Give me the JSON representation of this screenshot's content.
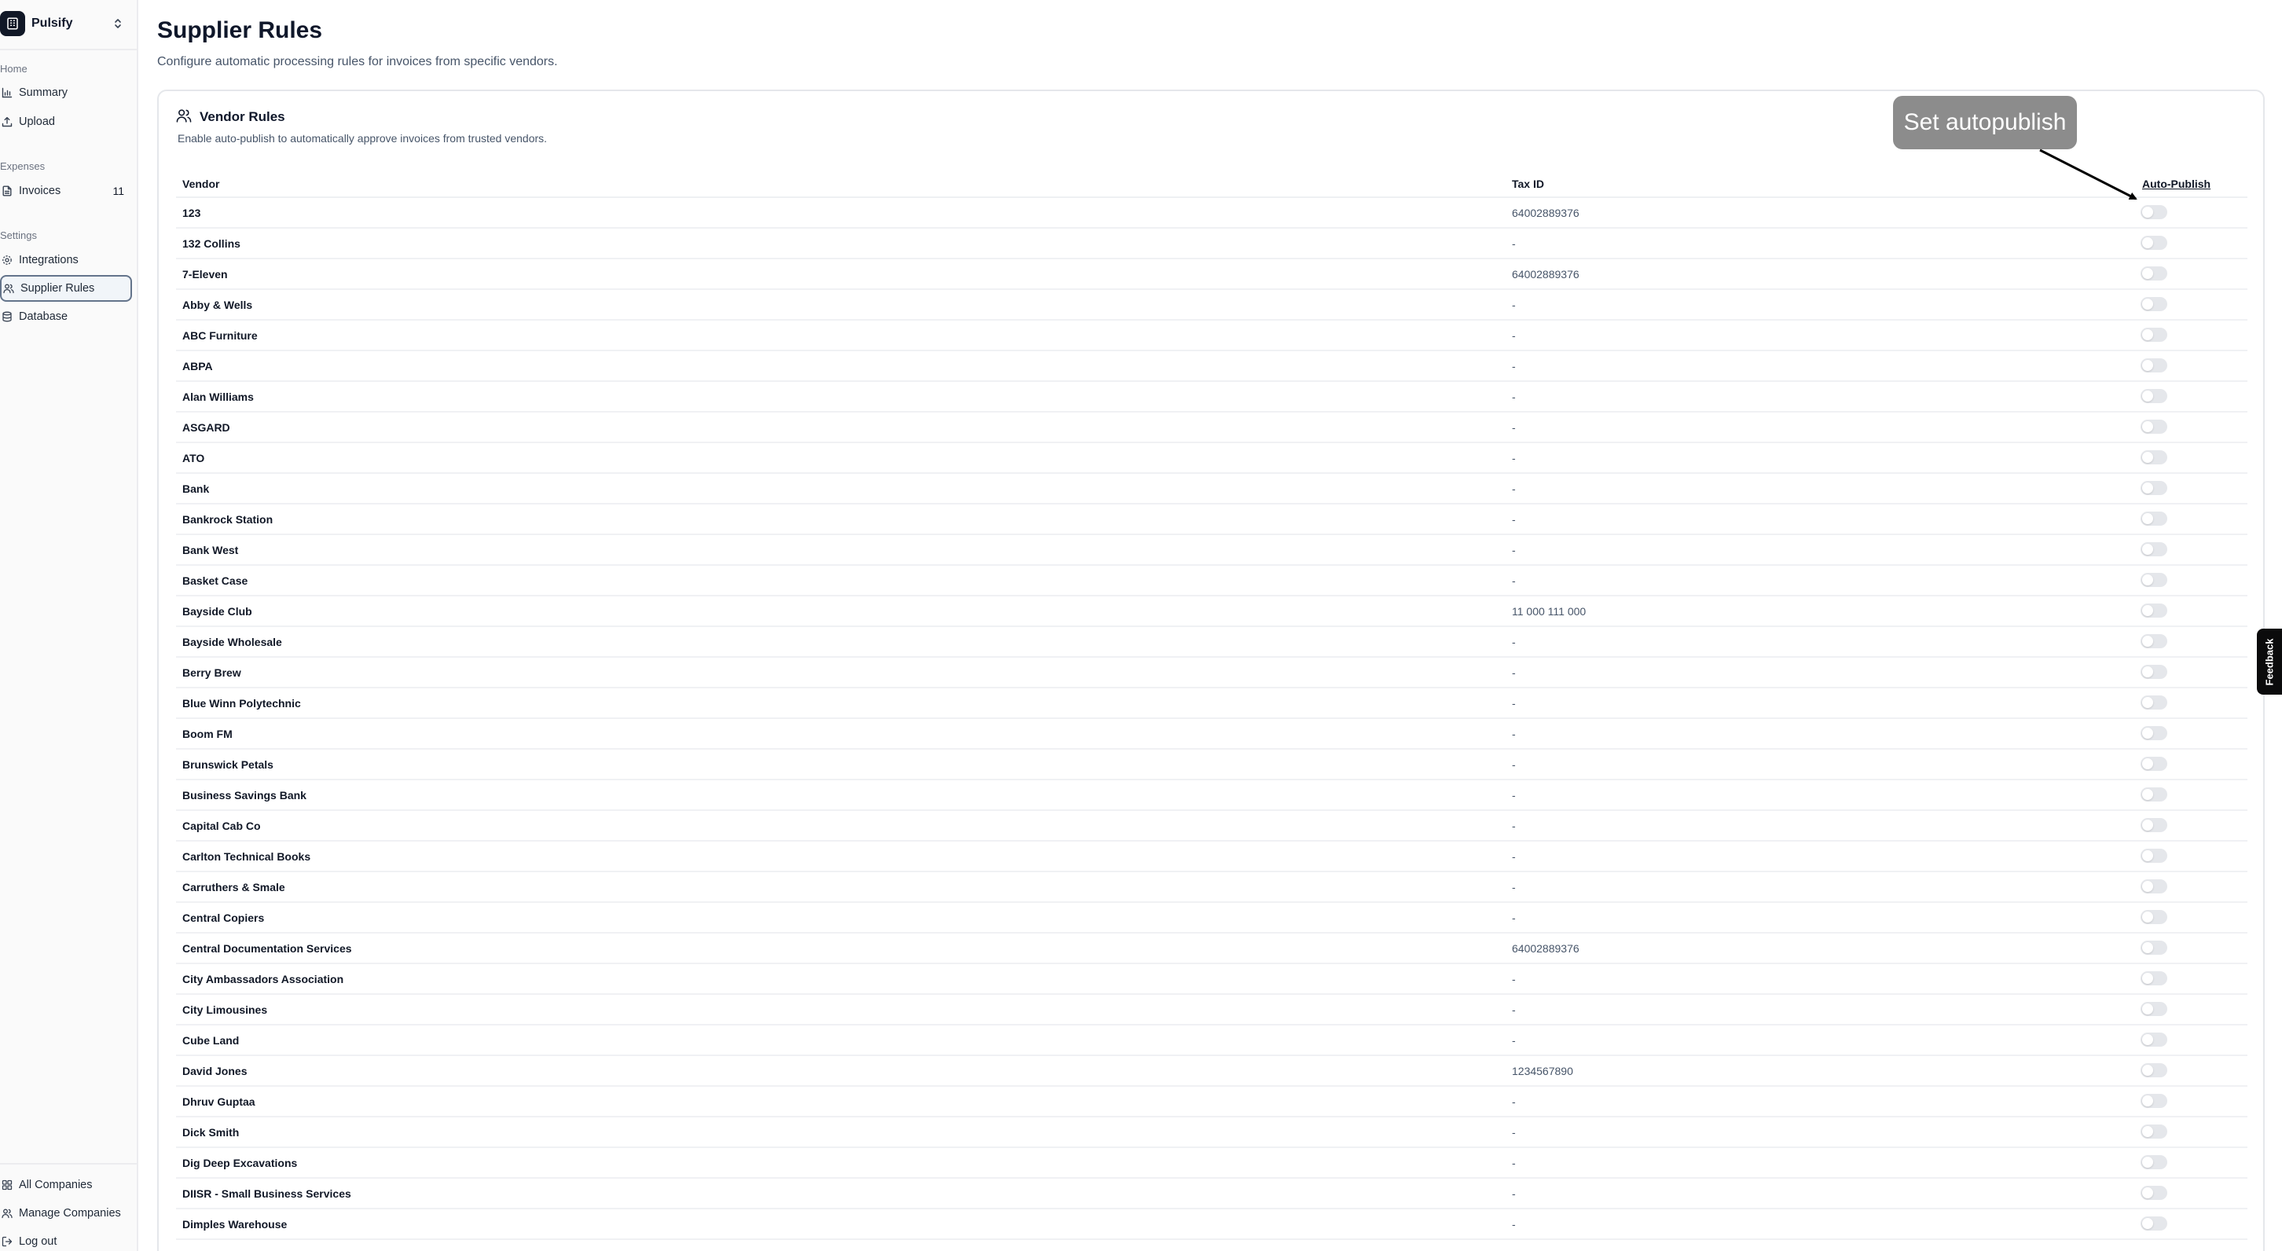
{
  "sidebar": {
    "brand": "Pulsify",
    "groups": {
      "home": "Home",
      "expenses": "Expenses",
      "settings": "Settings"
    },
    "items": {
      "summary": "Summary",
      "upload": "Upload",
      "invoices": "Invoices",
      "invoices_count": "11",
      "integrations": "Integrations",
      "supplier_rules": "Supplier Rules",
      "database": "Database"
    },
    "bottom": {
      "all_companies": "All Companies",
      "manage_companies": "Manage Companies",
      "log_out": "Log out"
    }
  },
  "page": {
    "title": "Supplier Rules",
    "subtitle": "Configure automatic processing rules for invoices from specific vendors."
  },
  "card": {
    "title": "Vendor Rules",
    "description": "Enable auto-publish to automatically approve invoices from trusted vendors."
  },
  "table": {
    "headers": {
      "vendor": "Vendor",
      "tax_id": "Tax ID",
      "auto_publish": "Auto-Publish"
    },
    "rows": [
      {
        "vendor": "123",
        "tax_id": "64002889376"
      },
      {
        "vendor": "132 Collins",
        "tax_id": "-"
      },
      {
        "vendor": "7-Eleven",
        "tax_id": "64002889376"
      },
      {
        "vendor": "Abby & Wells",
        "tax_id": "-"
      },
      {
        "vendor": "ABC Furniture",
        "tax_id": "-"
      },
      {
        "vendor": "ABPA",
        "tax_id": "-"
      },
      {
        "vendor": "Alan Williams",
        "tax_id": "-"
      },
      {
        "vendor": "ASGARD",
        "tax_id": "-"
      },
      {
        "vendor": "ATO",
        "tax_id": "-"
      },
      {
        "vendor": "Bank",
        "tax_id": "-"
      },
      {
        "vendor": "Bankrock Station",
        "tax_id": "-"
      },
      {
        "vendor": "Bank West",
        "tax_id": "-"
      },
      {
        "vendor": "Basket Case",
        "tax_id": "-"
      },
      {
        "vendor": "Bayside Club",
        "tax_id": "11 000 111 000"
      },
      {
        "vendor": "Bayside Wholesale",
        "tax_id": "-"
      },
      {
        "vendor": "Berry Brew",
        "tax_id": "-"
      },
      {
        "vendor": "Blue Winn Polytechnic",
        "tax_id": "-"
      },
      {
        "vendor": "Boom FM",
        "tax_id": "-"
      },
      {
        "vendor": "Brunswick Petals",
        "tax_id": "-"
      },
      {
        "vendor": "Business Savings Bank",
        "tax_id": "-"
      },
      {
        "vendor": "Capital Cab Co",
        "tax_id": "-"
      },
      {
        "vendor": "Carlton Technical Books",
        "tax_id": "-"
      },
      {
        "vendor": "Carruthers & Smale",
        "tax_id": "-"
      },
      {
        "vendor": "Central Copiers",
        "tax_id": "-"
      },
      {
        "vendor": "Central Documentation Services",
        "tax_id": "64002889376"
      },
      {
        "vendor": "City Ambassadors Association",
        "tax_id": "-"
      },
      {
        "vendor": "City Limousines",
        "tax_id": "-"
      },
      {
        "vendor": "Cube Land",
        "tax_id": "-"
      },
      {
        "vendor": "David Jones",
        "tax_id": "1234567890"
      },
      {
        "vendor": "Dhruv Guptaa",
        "tax_id": "-"
      },
      {
        "vendor": "Dick Smith",
        "tax_id": "-"
      },
      {
        "vendor": "Dig Deep Excavations",
        "tax_id": "-"
      },
      {
        "vendor": "DIISR - Small Business Services",
        "tax_id": "-"
      },
      {
        "vendor": "Dimples Warehouse",
        "tax_id": "-"
      }
    ]
  },
  "callout": {
    "text": "Set autopublish"
  },
  "feedback": {
    "label": "Feedback"
  }
}
